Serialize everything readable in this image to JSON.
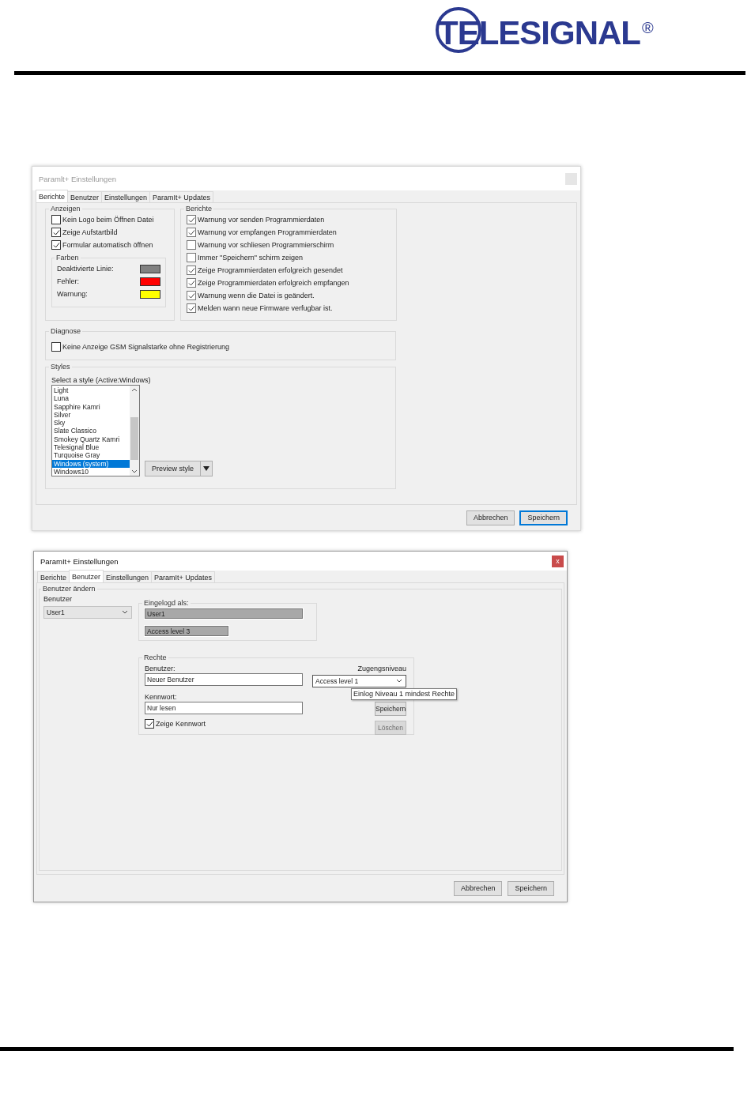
{
  "logo": {
    "text": "TELESIGNAL$^{®}$"
  },
  "dialogs": [
    {
      "kind": "reports",
      "title": "Paramlt+ Einstellungen",
      "active": false,
      "tabs": [
        {
          "label": "Berichte",
          "selected": true
        },
        {
          "label": "Benutzer",
          "selected": false
        },
        {
          "label": "Einstellungen",
          "selected": false
        },
        {
          "label": "ParamIt+ Updates",
          "selected": false
        }
      ],
      "display": {
        "title": "Anzeigen",
        "options": [
          {
            "label": "Kein Logo beim Öffnen Datei",
            "checked": false
          },
          {
            "label": "Zeige Aufstartbild",
            "checked": true
          },
          {
            "label": "Formular automatisch öffnen",
            "checked": true
          }
        ],
        "colors": {
          "title": "Farben",
          "rows": [
            {
              "label": "Deaktivierte Linie:",
              "color": "#808080"
            },
            {
              "label": "Fehler:",
              "color": "#ff0000"
            },
            {
              "label": "Warnung:",
              "color": "#ffff00"
            }
          ]
        }
      },
      "reports": {
        "title": "Berichte",
        "options": [
          {
            "label": "Warnung vor senden Programmierdaten",
            "checked": true
          },
          {
            "label": "Warnung vor empfangen Programmierdaten",
            "checked": true
          },
          {
            "label": "Warnung vor schliesen Programmierschirm",
            "checked": false
          },
          {
            "label": "Immer \"Speichern\" schirm zeigen",
            "checked": false
          },
          {
            "label": "Zeige Programmierdaten erfolgreich gesendet",
            "checked": true
          },
          {
            "label": "Zeige Programmierdaten erfolgreich empfangen",
            "checked": true
          },
          {
            "label": "Warnung wenn die Datei is geändert.",
            "checked": true
          },
          {
            "label": "Melden wann neue Firmware verfugbar ist.",
            "checked": true
          }
        ]
      },
      "diagnosis": {
        "title": "Diagnose",
        "options": [
          {
            "label": "Keine Anzeige GSM Signalstarke ohne Registrierung",
            "checked": false
          }
        ]
      },
      "styles": {
        "title": "Styles",
        "label": "Select a style (Active:Windows)",
        "items": [
          {
            "label": "Light",
            "selected": false
          },
          {
            "label": "Luna",
            "selected": false
          },
          {
            "label": "Sapphire Kamri",
            "selected": false
          },
          {
            "label": "Silver",
            "selected": false
          },
          {
            "label": "Sky",
            "selected": false
          },
          {
            "label": "Slate Classico",
            "selected": false
          },
          {
            "label": "Smokey Quartz Kamri",
            "selected": false
          },
          {
            "label": "Telesignal Blue",
            "selected": false
          },
          {
            "label": "Turquoise Gray",
            "selected": false
          },
          {
            "label": "Windows (system)",
            "selected": true
          },
          {
            "label": "Windows10",
            "selected": false
          }
        ],
        "preview_button": "Preview style"
      },
      "buttons": [
        {
          "label": "Abbrechen",
          "default": false
        },
        {
          "label": "Speichern",
          "default": true
        }
      ]
    },
    {
      "kind": "users",
      "title": "ParamIt+ Einstellungen",
      "active": true,
      "close_label": "x",
      "tabs": [
        {
          "label": "Berichte",
          "selected": false
        },
        {
          "label": "Benutzer",
          "selected": true
        },
        {
          "label": "Einstellungen",
          "selected": false
        },
        {
          "label": "ParamIt+ Updates",
          "selected": false
        }
      ],
      "change_user": {
        "title": "Benutzer ändern",
        "user_label": "Benutzer",
        "user_value": "User1"
      },
      "logged_in": {
        "title": "Eingelogd als:",
        "user": "User1",
        "level": "Access level 3"
      },
      "rights": {
        "title": "Rechte",
        "user_label": "Benutzer:",
        "user_value": "Neuer Benutzer",
        "level_label": "Zugengsniveau",
        "level_value": "Access level 1",
        "password_label": "Kennwort:",
        "password_value": "Nur lesen",
        "show_password": {
          "label": "Zeige Kennwort",
          "checked": true
        },
        "save_button": {
          "label": "Speichern",
          "disabled": false
        },
        "delete_button": {
          "label": "Löschen",
          "disabled": true
        },
        "tooltip": "Einlog Niveau 1 mindest Rechte"
      },
      "buttons": [
        {
          "label": "Abbrechen",
          "default": false
        },
        {
          "label": "Speichern",
          "default": false
        }
      ]
    }
  ]
}
